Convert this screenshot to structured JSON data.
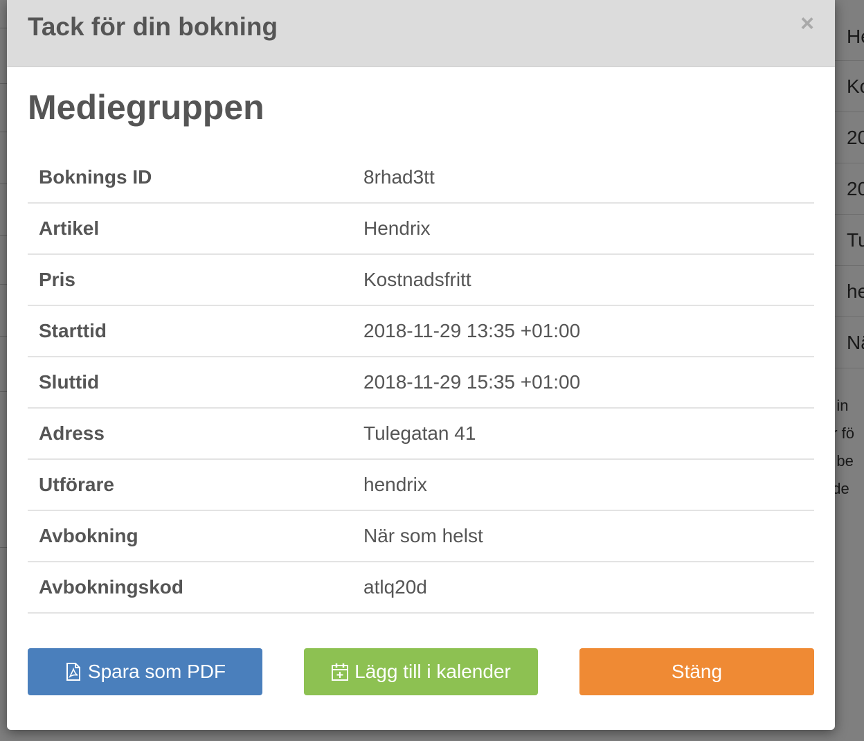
{
  "modal": {
    "title": "Tack för din bokning",
    "close_glyph": "×",
    "organization": "Mediegruppen"
  },
  "details": [
    {
      "label": "Boknings ID",
      "value": "8rhad3tt"
    },
    {
      "label": "Artikel",
      "value": "Hendrix"
    },
    {
      "label": "Pris",
      "value": "Kostnadsfritt"
    },
    {
      "label": "Starttid",
      "value": "2018-11-29 13:35 +01:00"
    },
    {
      "label": "Sluttid",
      "value": "2018-11-29 15:35 +01:00"
    },
    {
      "label": "Adress",
      "value": "Tulegatan 41"
    },
    {
      "label": "Utförare",
      "value": "hendrix"
    },
    {
      "label": "Avbokning",
      "value": "När som helst"
    },
    {
      "label": "Avbokningskod",
      "value": "atlq20d"
    }
  ],
  "actions": {
    "pdf_label": "Spara som PDF",
    "pdf_icon": "file-pdf-icon",
    "calendar_label": "Lägg till i kalender",
    "calendar_icon": "calendar-plus-icon",
    "close_label": "Stäng"
  },
  "colors": {
    "pdf_button": "#4a7fbc",
    "calendar_button": "#8dc152",
    "close_button": "#ef8a34",
    "header_bg": "#dcdcdc",
    "text": "#555555"
  },
  "background_page": {
    "rows": [
      "He",
      "Ko",
      "20",
      "20",
      "Tu",
      "he",
      "Nä"
    ],
    "text_lines": [
      "g in",
      "ar fö",
      "g be",
      "nde"
    ]
  }
}
